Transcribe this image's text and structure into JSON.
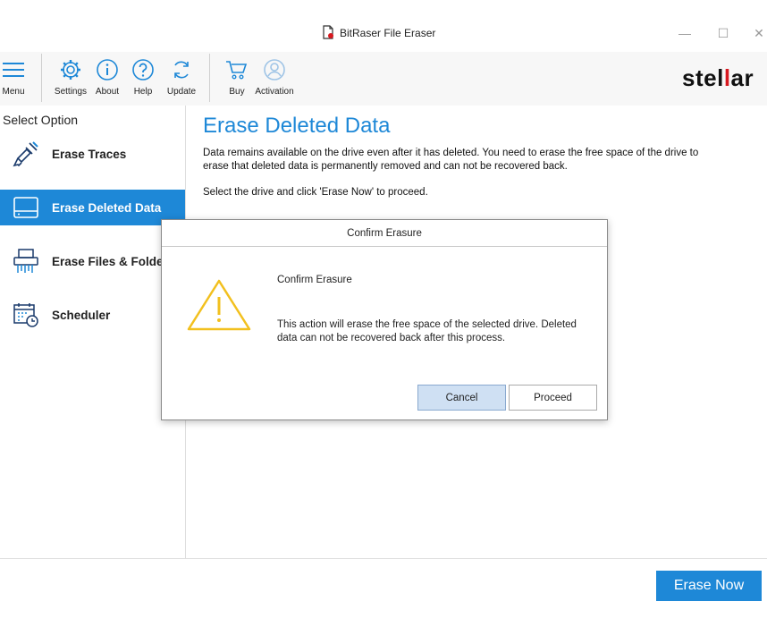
{
  "window": {
    "title": "BitRaser File Eraser",
    "minimize": "—",
    "maximize": "☐",
    "close": "✕"
  },
  "toolbar": {
    "menu": "Menu",
    "settings": "Settings",
    "about": "About",
    "help": "Help",
    "update": "Update",
    "buy": "Buy",
    "activation": "Activation"
  },
  "logo": {
    "pre": "stel",
    "mid": "l",
    "post": "ar"
  },
  "sidebar": {
    "heading": "Select Option",
    "items": [
      {
        "label": "Erase Traces",
        "icon": "brush-icon",
        "active": false
      },
      {
        "label": "Erase Deleted Data",
        "icon": "drive-icon",
        "active": true
      },
      {
        "label": "Erase Files & Folders",
        "icon": "shredder-icon",
        "active": false
      },
      {
        "label": "Scheduler",
        "icon": "calendar-clock-icon",
        "active": false
      }
    ]
  },
  "main": {
    "title": "Erase Deleted Data",
    "description": "Data remains available on the drive even after it has deleted. You need to erase the free space of the drive to erase that deleted data is permanently removed and can not be recovered back.",
    "instruction": "Select the drive and click 'Erase Now' to proceed."
  },
  "erase_now": "Erase Now",
  "dialog": {
    "title": "Confirm Erasure",
    "heading": "Confirm Erasure",
    "message": "This action will erase the free space of the selected drive. Deleted data can not be recovered back after this process.",
    "cancel": "Cancel",
    "proceed": "Proceed",
    "icon": "warning-icon"
  },
  "colors": {
    "accent": "#1e88d7",
    "logo_red": "#d71920",
    "warning": "#f2c01e"
  }
}
